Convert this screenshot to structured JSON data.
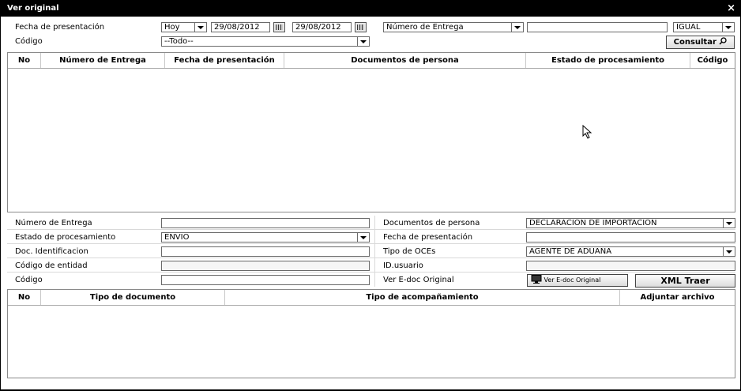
{
  "window": {
    "title": "Ver original",
    "close": "×"
  },
  "search": {
    "fecha_label": "Fecha de presentación",
    "fecha_period": "Hoy",
    "date_from": "29/08/2012",
    "date_to": "29/08/2012",
    "criterion": "Número de Entrega",
    "criterion_value": "",
    "operator": "IGUAL",
    "codigo_label": "Código",
    "codigo_value": "--Todo--",
    "consultar_label": "Consultar"
  },
  "results_table": {
    "columns": [
      "No",
      "Número de Entrega",
      "Fecha de presentación",
      "Documentos de persona",
      "Estado de procesamiento",
      "Código"
    ]
  },
  "detail": {
    "numero_entrega_label": "Número de Entrega",
    "numero_entrega_value": "",
    "estado_label": "Estado de procesamiento",
    "estado_value": "ENVIO",
    "doc_ident_label": "Doc. Identificacion",
    "doc_ident_value": "",
    "codigo_entidad_label": "Código de entidad",
    "codigo_entidad_value": "",
    "codigo_label": "Código",
    "codigo_value": "",
    "documentos_label": "Documentos de persona",
    "documentos_value": "DECLARACION DE IMPORTACION",
    "fecha_label": "Fecha de presentación",
    "fecha_value": "",
    "tipo_oces_label": "Tipo de OCEs",
    "tipo_oces_value": "AGENTE DE ADUANA",
    "id_usuario_label": "ID.usuario",
    "id_usuario_value": "",
    "ver_edoc_label": "Ver E-doc Original",
    "ver_edoc_button": "Ver E-doc Original",
    "xml_button": "XML Traer"
  },
  "attachments_table": {
    "columns": [
      "No",
      "Tipo de documento",
      "Tipo de acompañamiento",
      "Adjuntar archivo"
    ]
  }
}
